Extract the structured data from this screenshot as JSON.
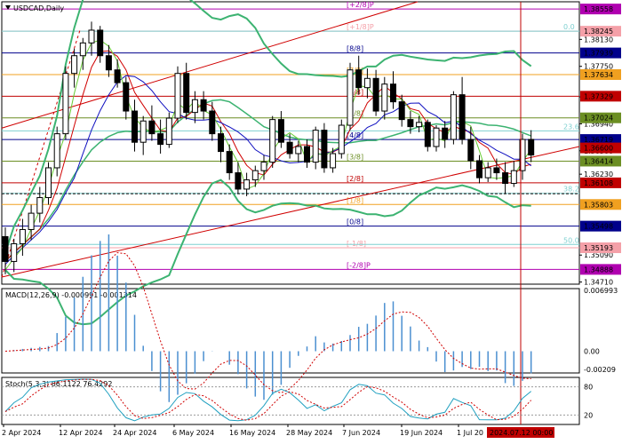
{
  "chart_data": {
    "type": "candlestick",
    "title": "USDCAD,Daily",
    "xlabels": [
      "2 Apr 2024",
      "12 Apr 2024",
      "24 Apr 2024",
      "6 May 2024",
      "16 May 2024",
      "28 May 2024",
      "7 Jun 2024",
      "19 Jun 2024",
      "1 Jul 20"
    ],
    "cursor_label": "2024.07.12 00:00",
    "ylim": [
      1.3468,
      1.3866
    ],
    "yticks": [
      "1.38130",
      "1.37750",
      "1.37320",
      "1.36940",
      "1.36560",
      "1.36230",
      "1.35090",
      "1.34710"
    ],
    "price_boxes": [
      {
        "label": "1.38558",
        "value": 1.38558,
        "color": "#b000b0"
      },
      {
        "label": "1.38245",
        "value": 1.38245,
        "color": "#f4a0a8"
      },
      {
        "label": "1.37939",
        "value": 1.37939,
        "color": "#00008b"
      },
      {
        "label": "1.37634",
        "value": 1.37634,
        "color": "#f0a020"
      },
      {
        "label": "1.37329",
        "value": 1.37329,
        "color": "#c00000"
      },
      {
        "label": "1.37024",
        "value": 1.37024,
        "color": "#6b8e23"
      },
      {
        "label": "1.36719",
        "value": 1.36719,
        "color": "#00008b"
      },
      {
        "label": "1.36600",
        "value": 1.366,
        "color": "#c00000"
      },
      {
        "label": "1.36414",
        "value": 1.36414,
        "color": "#6b8e23"
      },
      {
        "label": "1.36108",
        "value": 1.36108,
        "color": "#c00000"
      },
      {
        "label": "1.35803",
        "value": 1.35803,
        "color": "#f0a020"
      },
      {
        "label": "1.35498",
        "value": 1.35498,
        "color": "#00008b"
      },
      {
        "label": "1.35193",
        "value": 1.35193,
        "color": "#f4a0a8"
      },
      {
        "label": "1.34888",
        "value": 1.34888,
        "color": "#b000b0"
      }
    ],
    "murrey_levels": [
      {
        "label": "[+2/8]P",
        "value": 1.38558,
        "color": "#b000b0"
      },
      {
        "label": "[+1/8]P",
        "value": 1.38245,
        "color": "#f4a0a8"
      },
      {
        "label": "[8/8]",
        "value": 1.37939,
        "color": "#00008b"
      },
      {
        "label": "[7/8]",
        "value": 1.37634,
        "color": "#f0a020"
      },
      {
        "label": "[6/8]",
        "value": 1.37329,
        "color": "#c00000"
      },
      {
        "label": "[5/8]",
        "value": 1.37024,
        "color": "#6b8e23"
      },
      {
        "label": "[4/8]",
        "value": 1.36719,
        "color": "#00008b"
      },
      {
        "label": "[3/8]",
        "value": 1.36414,
        "color": "#6b8e23"
      },
      {
        "label": "[2/8]",
        "value": 1.36108,
        "color": "#c00000"
      },
      {
        "label": "[1/8]",
        "value": 1.35803,
        "color": "#f0a020"
      },
      {
        "label": "[0/8]",
        "value": 1.35498,
        "color": "#00008b"
      },
      {
        "label": "[-1/8]",
        "value": 1.35193,
        "color": "#f4a0a8"
      },
      {
        "label": "[-2/8]P",
        "value": 1.34888,
        "color": "#b000b0"
      }
    ],
    "fib_levels": [
      {
        "label": "0.0",
        "value": 1.38245
      },
      {
        "label": "23.6",
        "value": 1.3684
      },
      {
        "label": "38.2",
        "value": 1.3596
      },
      {
        "label": "50.0",
        "value": 1.3524
      }
    ],
    "candles": [
      [
        1.3535,
        1.3548,
        1.3482,
        1.35
      ],
      [
        1.35,
        1.3532,
        1.3485,
        1.3525
      ],
      [
        1.3525,
        1.356,
        1.3508,
        1.3545
      ],
      [
        1.3545,
        1.358,
        1.353,
        1.3568
      ],
      [
        1.3568,
        1.3605,
        1.3555,
        1.359
      ],
      [
        1.359,
        1.364,
        1.358,
        1.3632
      ],
      [
        1.3632,
        1.369,
        1.362,
        1.368
      ],
      [
        1.368,
        1.3775,
        1.3672,
        1.3765
      ],
      [
        1.3765,
        1.38,
        1.3745,
        1.379
      ],
      [
        1.379,
        1.3815,
        1.377,
        1.3808
      ],
      [
        1.3808,
        1.3838,
        1.379,
        1.3826
      ],
      [
        1.3826,
        1.3832,
        1.378,
        1.379
      ],
      [
        1.379,
        1.3805,
        1.376,
        1.377
      ],
      [
        1.377,
        1.3785,
        1.3745,
        1.3752
      ],
      [
        1.3752,
        1.376,
        1.37,
        1.3712
      ],
      [
        1.3712,
        1.3728,
        1.3655,
        1.3668
      ],
      [
        1.3668,
        1.3705,
        1.365,
        1.3698
      ],
      [
        1.3698,
        1.372,
        1.367,
        1.368
      ],
      [
        1.368,
        1.37,
        1.3652,
        1.3665
      ],
      [
        1.3665,
        1.371,
        1.366,
        1.3702
      ],
      [
        1.3702,
        1.3775,
        1.3695,
        1.3765
      ],
      [
        1.3765,
        1.378,
        1.37,
        1.371
      ],
      [
        1.371,
        1.374,
        1.3695,
        1.3728
      ],
      [
        1.3728,
        1.374,
        1.37,
        1.3712
      ],
      [
        1.3712,
        1.3725,
        1.367,
        1.368
      ],
      [
        1.368,
        1.369,
        1.364,
        1.3655
      ],
      [
        1.3655,
        1.3665,
        1.3615,
        1.3625
      ],
      [
        1.3625,
        1.364,
        1.3595,
        1.3602
      ],
      [
        1.3602,
        1.3625,
        1.3592,
        1.3615
      ],
      [
        1.3615,
        1.3635,
        1.3605,
        1.3628
      ],
      [
        1.3628,
        1.365,
        1.3615,
        1.364
      ],
      [
        1.364,
        1.3705,
        1.3632,
        1.37
      ],
      [
        1.37,
        1.3712,
        1.366,
        1.3668
      ],
      [
        1.3668,
        1.368,
        1.3645,
        1.3652
      ],
      [
        1.3652,
        1.367,
        1.364,
        1.3662
      ],
      [
        1.3662,
        1.3672,
        1.3632,
        1.364
      ],
      [
        1.364,
        1.369,
        1.363,
        1.3685
      ],
      [
        1.3685,
        1.3695,
        1.3625,
        1.3632
      ],
      [
        1.3632,
        1.366,
        1.3625,
        1.3652
      ],
      [
        1.3652,
        1.37,
        1.3645,
        1.3692
      ],
      [
        1.3692,
        1.378,
        1.3685,
        1.377
      ],
      [
        1.377,
        1.379,
        1.3735,
        1.3745
      ],
      [
        1.3745,
        1.3772,
        1.373,
        1.3758
      ],
      [
        1.3758,
        1.377,
        1.3705,
        1.3712
      ],
      [
        1.3712,
        1.376,
        1.37,
        1.375
      ],
      [
        1.375,
        1.3768,
        1.3715,
        1.3725
      ],
      [
        1.3725,
        1.3735,
        1.369,
        1.37
      ],
      [
        1.37,
        1.3712,
        1.368,
        1.369
      ],
      [
        1.369,
        1.3705,
        1.3682,
        1.3696
      ],
      [
        1.3696,
        1.37,
        1.3655,
        1.3662
      ],
      [
        1.3662,
        1.3692,
        1.3655,
        1.3688
      ],
      [
        1.3688,
        1.3698,
        1.366,
        1.3672
      ],
      [
        1.3672,
        1.374,
        1.3665,
        1.3735
      ],
      [
        1.3735,
        1.376,
        1.3665,
        1.3672
      ],
      [
        1.3672,
        1.369,
        1.363,
        1.3642
      ],
      [
        1.3642,
        1.365,
        1.361,
        1.3618
      ],
      [
        1.3618,
        1.364,
        1.3612,
        1.3632
      ],
      [
        1.3632,
        1.3645,
        1.3615,
        1.3625
      ],
      [
        1.3625,
        1.364,
        1.3595,
        1.361
      ],
      [
        1.361,
        1.3642,
        1.3605,
        1.3628
      ],
      [
        1.3628,
        1.368,
        1.3615,
        1.3672
      ],
      [
        1.3672,
        1.3685,
        1.364,
        1.365
      ]
    ],
    "indicators": [
      {
        "name": "MACD(12,26,9)",
        "values": [
          "-0.000991",
          "-0.001314"
        ],
        "yticks": [
          "0.006993",
          "0.00",
          "-0.00209"
        ]
      },
      {
        "name": "Stoch(5,3,3)",
        "values": [
          "86.1122",
          "76.4292"
        ],
        "yticks": [
          "80",
          "20"
        ]
      }
    ]
  }
}
